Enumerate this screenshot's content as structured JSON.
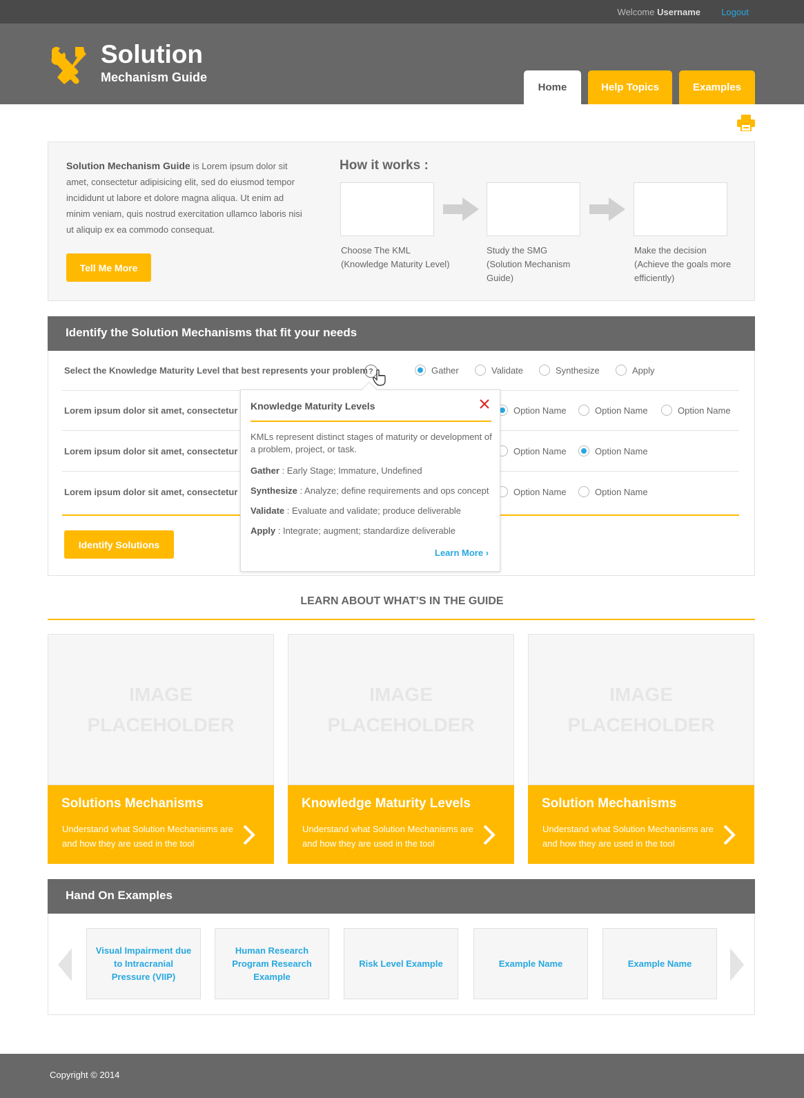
{
  "topbar": {
    "welcome": "Welcome",
    "username": "Username",
    "logout": "Logout"
  },
  "brand": {
    "title": "Solution",
    "subtitle": "Mechanism Guide"
  },
  "nav": {
    "home": "Home",
    "help": "Help Topics",
    "examples": "Examples"
  },
  "intro": {
    "lead": "Solution Mechanism Guide",
    "text": " is Lorem ipsum dolor sit amet, consectetur adipisicing elit, sed do eiusmod tempor incididunt ut labore et dolore magna aliqua. Ut enim ad minim veniam, quis nostrud exercitation ullamco laboris nisi ut aliquip ex ea commodo consequat.",
    "button": "Tell Me More",
    "how_title": "How it works :",
    "steps": [
      {
        "line1": "Choose The KML",
        "line2": "(Knowledge Maturity  Level)"
      },
      {
        "line1": "Study the SMG",
        "line2": "(Solution Mechanism Guide)"
      },
      {
        "line1": "Make the decision",
        "line2": "(Achieve the goals more efficiently)"
      }
    ]
  },
  "identify": {
    "title": "Identify the Solution Mechanisms that fit your needs",
    "q1": "Select the Knowledge Maturity Level that best represents your problem",
    "q1_options": [
      "Gather",
      "Validate",
      "Synthesize",
      "Apply"
    ],
    "q_other": "Lorem ipsum dolor sit amet, consectetur ac",
    "option_name": "Option Name",
    "button": "Identify Solutions",
    "help": "?"
  },
  "popup": {
    "title": "Knowledge Maturity Levels",
    "desc": "KMLs represent distinct stages of maturity or development of a problem, project, or task.",
    "items": [
      {
        "term": "Gather",
        "text": " : Early Stage; Immature, Undefined"
      },
      {
        "term": "Synthesize",
        "text": " : Analyze; define requirements and ops concept"
      },
      {
        "term": "Validate",
        "text": " : Evaluate and validate; produce deliverable"
      },
      {
        "term": "Apply",
        "text": " : Integrate; augment; standardize deliverable"
      }
    ],
    "learn_more": "Learn More"
  },
  "learn": {
    "title": "LEARN ABOUT WHAT’S IN THE GUIDE",
    "placeholder_line1": "IMAGE",
    "placeholder_line2": "PLACEHOLDER",
    "cards": [
      {
        "title": "Solutions Mechanisms",
        "desc": "Understand what Solution Mechanisms are and how they are used in the tool"
      },
      {
        "title": "Knowledge Maturity Levels",
        "desc": "Understand what Solution Mechanisms are and how they are used in the tool"
      },
      {
        "title": "Solution Mechanisms",
        "desc": "Understand what Solution Mechanisms are and how they are used in the tool"
      }
    ]
  },
  "examples": {
    "title": "Hand On Examples",
    "items": [
      "Visual Impairment due to Intracranial Pressure (VIIP)",
      "Human Research Program Research Example",
      "Risk Level Example",
      "Example Name",
      "Example Name"
    ]
  },
  "footer": {
    "copyright": "Copyright © 2014"
  },
  "colors": {
    "accent": "#ffb900",
    "link": "#27a8e0",
    "header": "#686868"
  }
}
